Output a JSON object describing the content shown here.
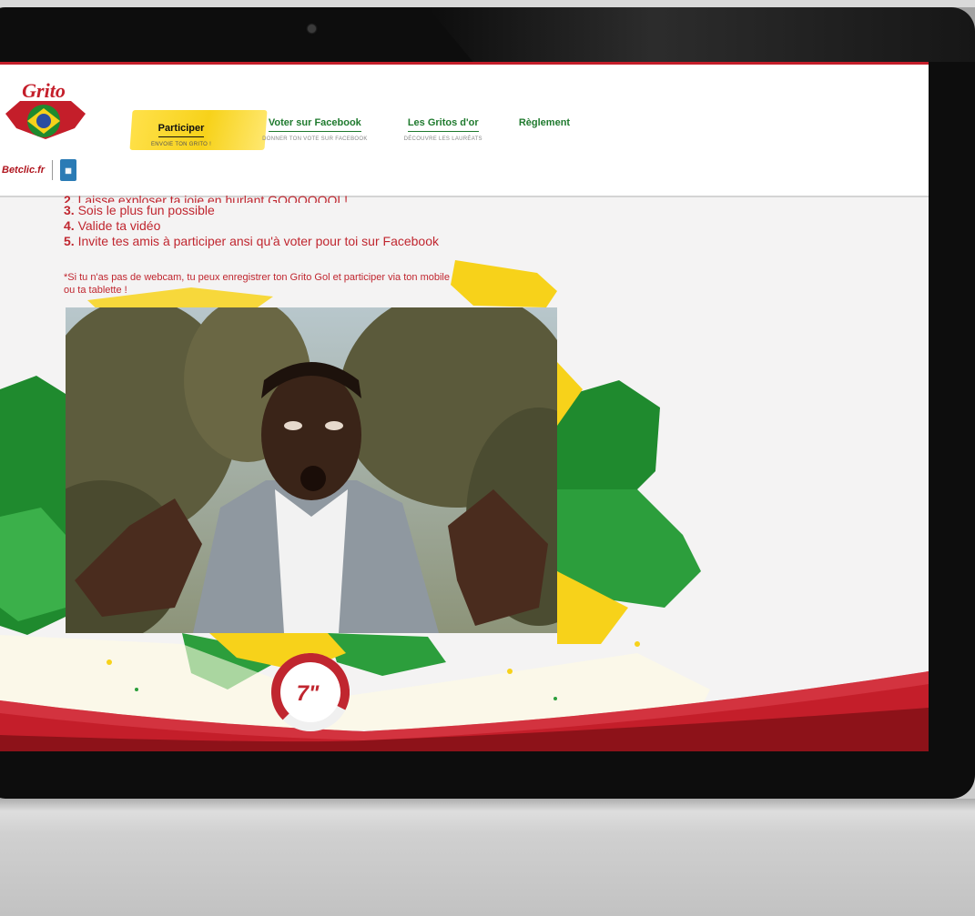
{
  "nav": {
    "items": [
      {
        "label": "Participer",
        "sub": "ENVOIE TON GRITO !",
        "active": true
      },
      {
        "label": "Voter sur Facebook",
        "sub": "DONNER TON VOTE SUR FACEBOOK",
        "active": false
      },
      {
        "label": "Les Gritos d'or",
        "sub": "DÉCOUVRE LES LAURÉATS",
        "active": false
      },
      {
        "label": "Règlement",
        "sub": "",
        "active": false
      }
    ]
  },
  "brand": {
    "logo_text": "Grito",
    "partner": "Betclic.fr"
  },
  "steps": [
    {
      "num": "2.",
      "text": "Laisse exploser ta joie en hurlant GOOOOOOL!"
    },
    {
      "num": "3.",
      "text": "Sois le plus fun possible"
    },
    {
      "num": "4.",
      "text": "Valide ta vidéo"
    },
    {
      "num": "5.",
      "text": "Invite tes amis à participer ansi qu'à voter pour toi sur Facebook"
    }
  ],
  "note": "*Si tu n'as pas de webcam, tu peux enregistrer ton Grito Gol et participer via ton mobile ou ta tablette !",
  "timer": {
    "value": "7\"",
    "progress": 0.7
  },
  "colors": {
    "accent_red": "#c0262f",
    "green": "#1f8a2e",
    "yellow": "#f7d21a"
  }
}
